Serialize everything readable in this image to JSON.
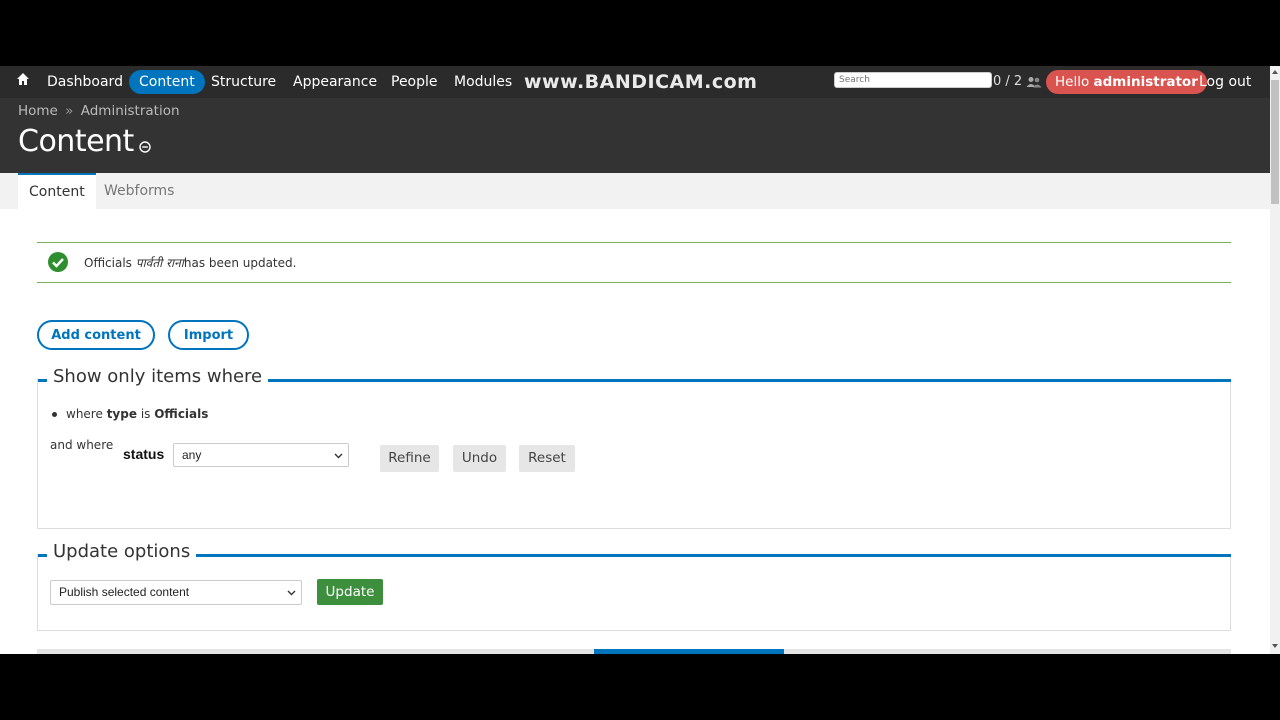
{
  "toolbar": {
    "items": [
      "Dashboard",
      "Content",
      "Structure",
      "Appearance",
      "People",
      "Modules"
    ],
    "active_item": "Content",
    "search_placeholder": "Search",
    "user_count": "0 / 2",
    "hello_prefix": "Hello",
    "username": "administrator",
    "logout": "Log out",
    "watermark": "www.BANDICAM.com"
  },
  "breadcrumb": {
    "home": "Home",
    "separator": "»",
    "admin": "Administration"
  },
  "page_title": "Content",
  "tabs": [
    {
      "label": "Content",
      "active": true
    },
    {
      "label": "Webforms",
      "active": false
    }
  ],
  "message": {
    "prefix": "Officials",
    "name": "पार्वती राना",
    "suffix": "has been updated."
  },
  "actions": {
    "add_content": "Add content",
    "import": "Import"
  },
  "filter": {
    "legend": "Show only items where",
    "where_prefix": "where",
    "where_field": "type",
    "where_is": "is",
    "where_value": "Officials",
    "and_where": "and where",
    "status_label": "status",
    "status_value": "any",
    "refine": "Refine",
    "undo": "Undo",
    "reset": "Reset"
  },
  "update": {
    "legend": "Update options",
    "selected_option": "Publish selected content",
    "button": "Update"
  },
  "colors": {
    "toolbar_bg": "#2b2b2b",
    "accent": "#0074bd",
    "hello_bg": "#d9534f",
    "success": "#77b259",
    "update_btn": "#3d8f3d"
  }
}
